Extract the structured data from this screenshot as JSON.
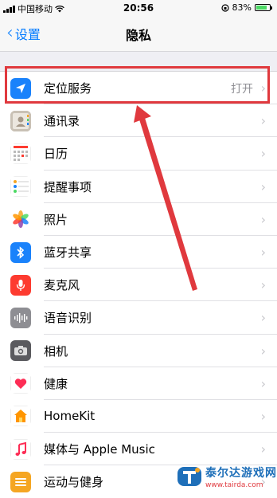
{
  "status_bar": {
    "carrier": "中国移动",
    "time": "20:56",
    "battery": "83%",
    "battery_level": 0.83
  },
  "nav": {
    "back_label": "设置",
    "title": "隐私"
  },
  "rows": [
    {
      "label": "定位服务",
      "value": "打开",
      "icon": "location-arrow-icon",
      "color": "#1a82fb"
    },
    {
      "label": "通讯录",
      "value": "",
      "icon": "contacts-icon",
      "color": "#b0a493"
    },
    {
      "label": "日历",
      "value": "",
      "icon": "calendar-icon",
      "color": "#ffffff"
    },
    {
      "label": "提醒事项",
      "value": "",
      "icon": "reminders-icon",
      "color": "#ffffff"
    },
    {
      "label": "照片",
      "value": "",
      "icon": "photos-icon",
      "color": "#ffffff"
    },
    {
      "label": "蓝牙共享",
      "value": "",
      "icon": "bluetooth-icon",
      "color": "#1a82fb"
    },
    {
      "label": "麦克风",
      "value": "",
      "icon": "microphone-icon",
      "color": "#fd3b30"
    },
    {
      "label": "语音识别",
      "value": "",
      "icon": "waveform-icon",
      "color": "#8e8e93"
    },
    {
      "label": "相机",
      "value": "",
      "icon": "camera-icon",
      "color": "#5a5a5e"
    },
    {
      "label": "健康",
      "value": "",
      "icon": "health-heart-icon",
      "color": "#ffffff"
    },
    {
      "label": "HomeKit",
      "value": "",
      "icon": "home-icon",
      "color": "#ffffff"
    },
    {
      "label": "媒体与 Apple Music",
      "value": "",
      "icon": "music-icon",
      "color": "#ffffff"
    },
    {
      "label": "运动与健身",
      "value": "",
      "icon": "fitness-icon",
      "color": "#f5a623"
    }
  ],
  "watermark": {
    "title": "泰尔达游戏网",
    "url": "www.tairda.com"
  },
  "colors": {
    "accent": "#007aff",
    "annotation": "#e0393e"
  }
}
